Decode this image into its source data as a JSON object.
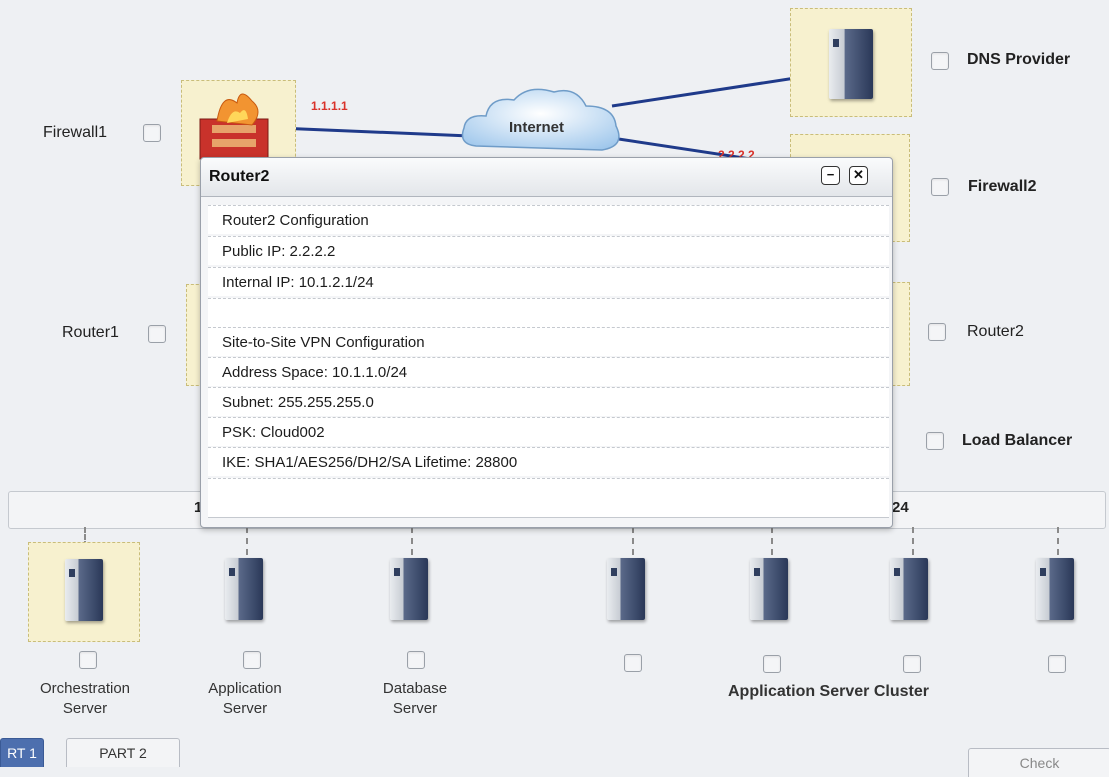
{
  "devices": {
    "firewall1": {
      "label": "Firewall1",
      "ip": "1.1.1.1"
    },
    "dns": {
      "label": "DNS Provider"
    },
    "firewall2": {
      "label": "Firewall2",
      "ip": "2.2.2.2"
    },
    "router1": {
      "label": "Router1"
    },
    "router2": {
      "label": "Router2"
    },
    "load_balancer": {
      "label": "Load Balancer"
    },
    "internet": {
      "label": "Internet"
    }
  },
  "network_bar": {
    "left_text": "10",
    "right_text": "24"
  },
  "servers": {
    "orchestration": {
      "label_line1": "Orchestration",
      "label_line2": "Server"
    },
    "application": {
      "label_line1": "Application",
      "label_line2": "Server"
    },
    "database": {
      "label_line1": "Database",
      "label_line2": "Server"
    },
    "cluster_label": "Application Server Cluster"
  },
  "popup": {
    "title": "Router2",
    "minimize_glyph": "−",
    "close_glyph": "✕",
    "rows": [
      "Router2 Configuration",
      "Public IP: 2.2.2.2",
      "Internal IP: 10.1.2.1/24",
      "",
      "Site-to-Site VPN Configuration",
      "Address Space: 10.1.1.0/24",
      "Subnet: 255.255.255.0",
      "PSK: Cloud002",
      "IKE: SHA1/AES256/DH2/SA Lifetime: 28800"
    ]
  },
  "tabs": {
    "part1": "RT 1",
    "part2": "PART 2",
    "right": "Check"
  },
  "colors": {
    "link_line": "#1f3a8a",
    "ip_red": "#d9322a",
    "device_highlight": "#f7f1cf"
  }
}
